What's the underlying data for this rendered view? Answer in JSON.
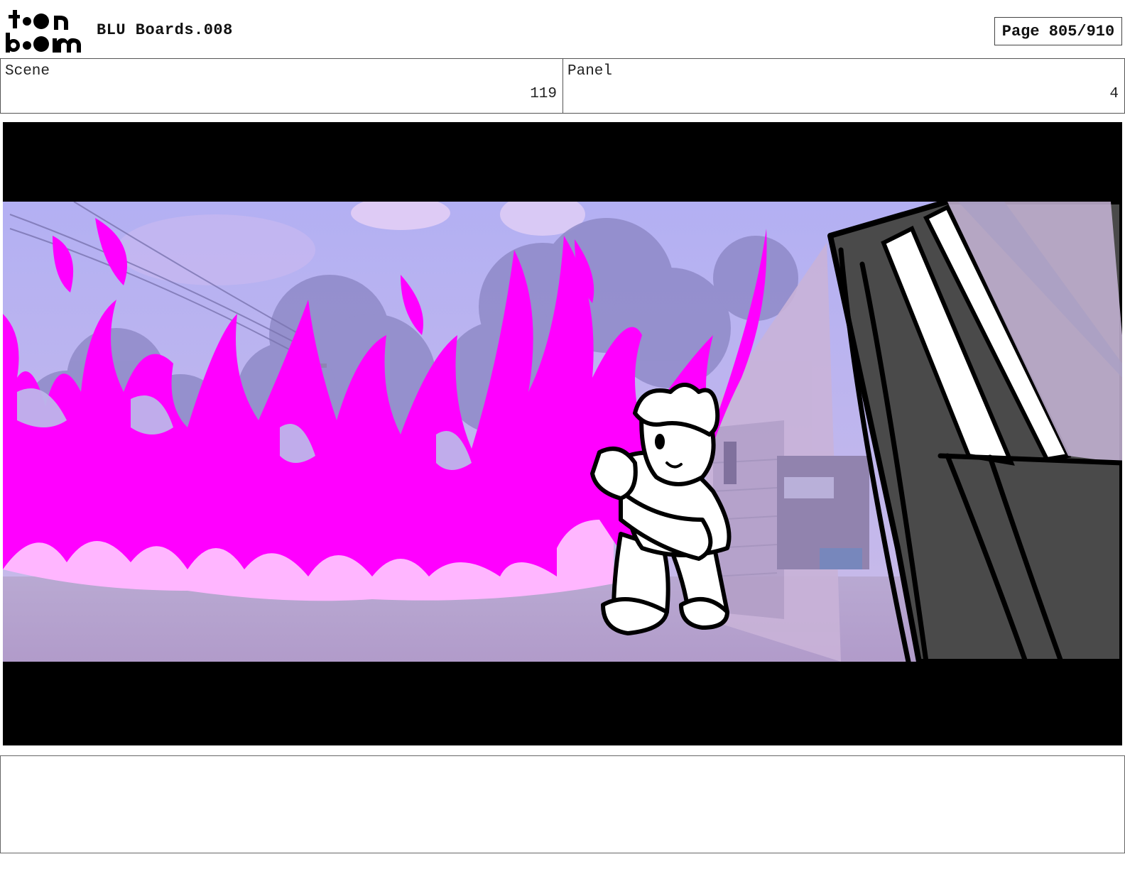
{
  "header": {
    "logo_alt": "toon boom",
    "title": "BLU Boards.008",
    "page_label": "Page 805/910"
  },
  "scene": {
    "label": "Scene",
    "value": "119"
  },
  "panel": {
    "label": "Panel",
    "value": "4"
  },
  "notes": {
    "text": ""
  },
  "colors": {
    "letterbox": "#000000",
    "sky": "#b9b5ee",
    "flame_magenta": "#ff00ff",
    "flame_pink": "#ffb8ff",
    "ground": "#b6a4cc",
    "door_dark": "#4a4a4a"
  }
}
